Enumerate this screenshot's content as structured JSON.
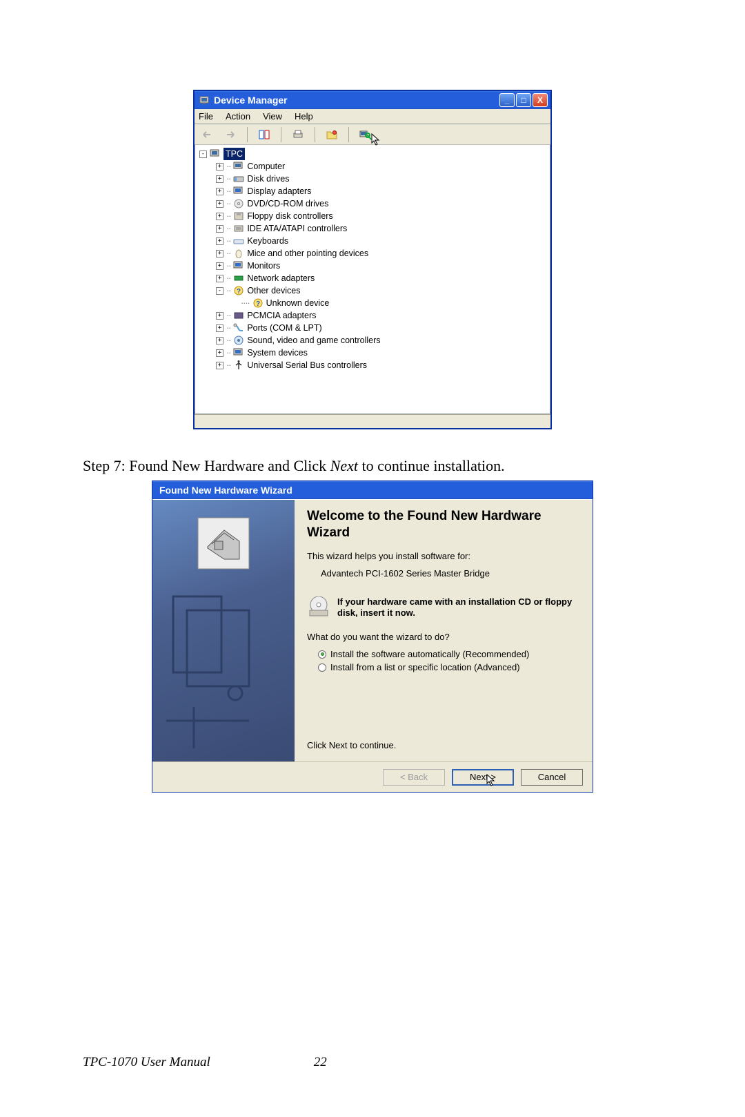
{
  "device_manager": {
    "title": "Device Manager",
    "menu": {
      "file": "File",
      "action": "Action",
      "view": "View",
      "help": "Help"
    },
    "root": "TPC",
    "nodes": [
      "Computer",
      "Disk drives",
      "Display adapters",
      "DVD/CD-ROM drives",
      "Floppy disk controllers",
      "IDE ATA/ATAPI controllers",
      "Keyboards",
      "Mice and other pointing devices",
      "Monitors",
      "Network adapters",
      "Other devices",
      "PCMCIA adapters",
      "Ports (COM & LPT)",
      "Sound, video and game controllers",
      "System devices",
      "Universal Serial Bus controllers"
    ],
    "other_devices_child": "Unknown device",
    "window_buttons": {
      "min": "_",
      "max": "□",
      "close": "X"
    },
    "toolbar_icons": [
      "back-icon",
      "forward-icon",
      "properties-icon",
      "print-icon",
      "folder-icon",
      "scan-icon"
    ]
  },
  "caption": {
    "prefix": "Step 7: Found New Hardware and Click ",
    "em": "Next",
    "suffix": " to continue installation."
  },
  "wizard": {
    "title": "Found New Hardware Wizard",
    "heading": "Welcome to the Found New Hardware Wizard",
    "intro": "This wizard helps you install software for:",
    "device": "Advantech PCI-1602 Series Master Bridge",
    "alert": "If your hardware came with an installation CD or floppy disk, insert it now.",
    "question": "What do you want the wizard to do?",
    "opt_auto": "Install the software automatically (Recommended)",
    "opt_list": "Install from a list or specific location (Advanced)",
    "continue": "Click Next to continue.",
    "buttons": {
      "back": "< Back",
      "next": "Next >",
      "cancel": "Cancel"
    }
  },
  "footer": {
    "manual": "TPC-1070  User Manual",
    "page": "22"
  }
}
